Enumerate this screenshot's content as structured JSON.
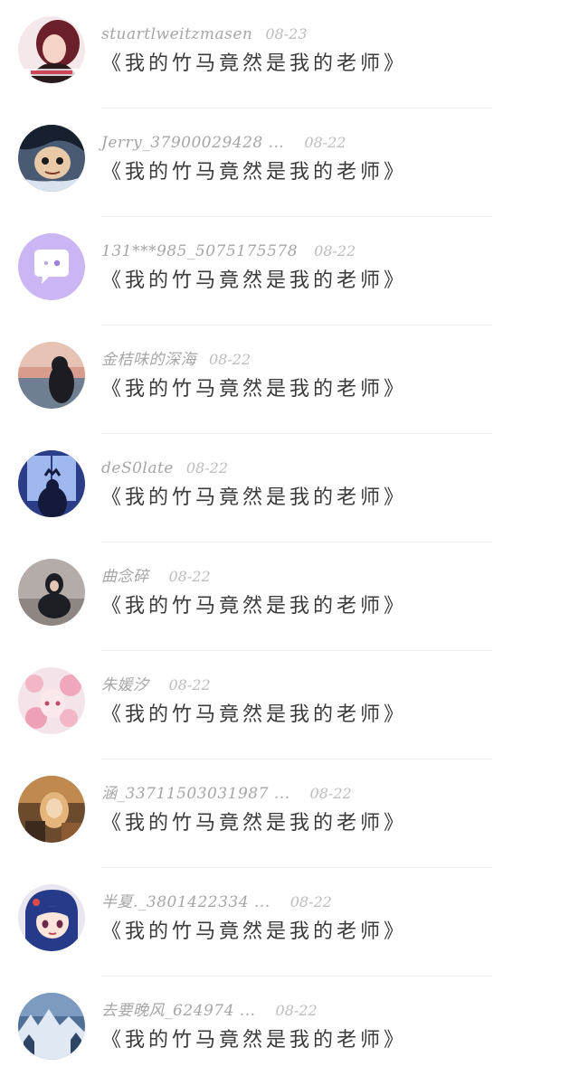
{
  "comments": [
    {
      "username": "stuartlweitzmasen",
      "date": "08-23",
      "text": "《我的竹马竟然是我的老师》",
      "avatar": "avatar-girl-red-icon"
    },
    {
      "username": "Jerry_37900029428 ...",
      "date": "08-22",
      "text": "《我的竹马竟然是我的老师》",
      "avatar": "avatar-anime-boy-icon"
    },
    {
      "username": "131***985_5075175578",
      "date": "08-22",
      "text": "《我的竹马竟然是我的老师》",
      "avatar": "avatar-default-chat-icon"
    },
    {
      "username": "金桔味的深海",
      "date": "08-22",
      "text": "《我的竹马竟然是我的老师》",
      "avatar": "avatar-sunset-girl-icon"
    },
    {
      "username": "deS0late",
      "date": "08-22",
      "text": "《我的竹马竟然是我的老师》",
      "avatar": "avatar-blue-window-icon"
    },
    {
      "username": "曲念碎",
      "date": "08-22",
      "text": "《我的竹马竟然是我的老师》",
      "avatar": "avatar-sitting-girl-icon"
    },
    {
      "username": "朱媛汐",
      "date": "08-22",
      "text": "《我的竹马竟然是我的老师》",
      "avatar": "avatar-pink-anime-icon"
    },
    {
      "username": "涵_33711503031987 ...",
      "date": "08-22",
      "text": "《我的竹马竟然是我的老师》",
      "avatar": "avatar-warm-portrait-icon"
    },
    {
      "username": "半夏._3801422334 ...",
      "date": "08-22",
      "text": "《我的竹马竟然是我的老师》",
      "avatar": "avatar-anime-girl-blue-hair-icon"
    },
    {
      "username": "去要晚风_624974 ...",
      "date": "08-22",
      "text": "《我的竹马竟然是我的老师》",
      "avatar": "avatar-snowy-landscape-icon"
    }
  ],
  "colors": {
    "username": "#a6a6a6",
    "date": "#bdbdbd",
    "text": "#3a3a3a",
    "divider": "#eeeeee",
    "default_avatar": "#c9b6f2"
  }
}
